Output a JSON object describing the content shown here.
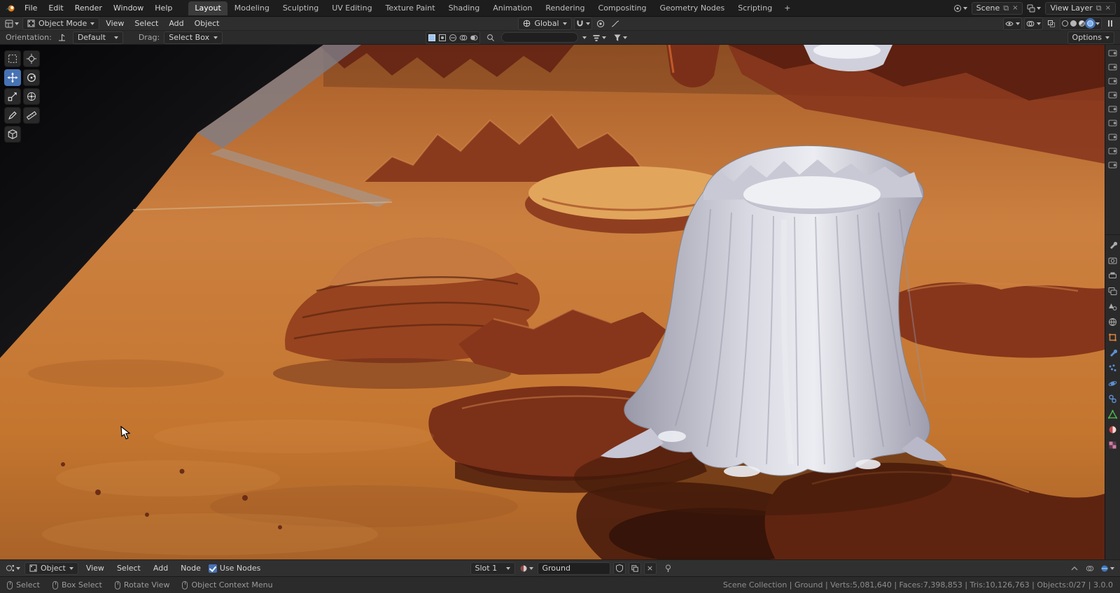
{
  "topbar": {
    "app_menus": [
      "File",
      "Edit",
      "Render",
      "Window",
      "Help"
    ],
    "workspaces": [
      "Layout",
      "Modeling",
      "Sculpting",
      "UV Editing",
      "Texture Paint",
      "Shading",
      "Animation",
      "Rendering",
      "Compositing",
      "Geometry Nodes",
      "Scripting"
    ],
    "active_workspace": "Layout",
    "add_workspace": "+",
    "scene_name": "Scene",
    "view_layer_name": "View Layer"
  },
  "viewport_header": {
    "mode": "Object Mode",
    "menus": [
      "View",
      "Select",
      "Add",
      "Object"
    ],
    "transform_orientation": "Global",
    "options": "Options"
  },
  "tool_settings": {
    "orientation_label": "Orientation:",
    "orientation_value": "Default",
    "drag_label": "Drag:",
    "drag_value": "Select Box"
  },
  "shader_editor": {
    "id_type": "Object",
    "menus": [
      "View",
      "Select",
      "Add",
      "Node"
    ],
    "use_nodes_label": "Use Nodes",
    "slot_label": "Slot 1",
    "material_name": "Ground"
  },
  "status_bar": {
    "hints": [
      "Select",
      "Box Select",
      "Rotate View",
      "Object Context Menu"
    ],
    "stats": "Scene Collection | Ground | Verts:5,081,640 | Faces:7,398,853 | Tris:10,126,763 | Objects:0/27 | 3.0.0"
  },
  "colors": {
    "accent": "#4772b3",
    "ground": "#c97a38",
    "rock": "#87361b",
    "stump": "#d8d8e2"
  }
}
